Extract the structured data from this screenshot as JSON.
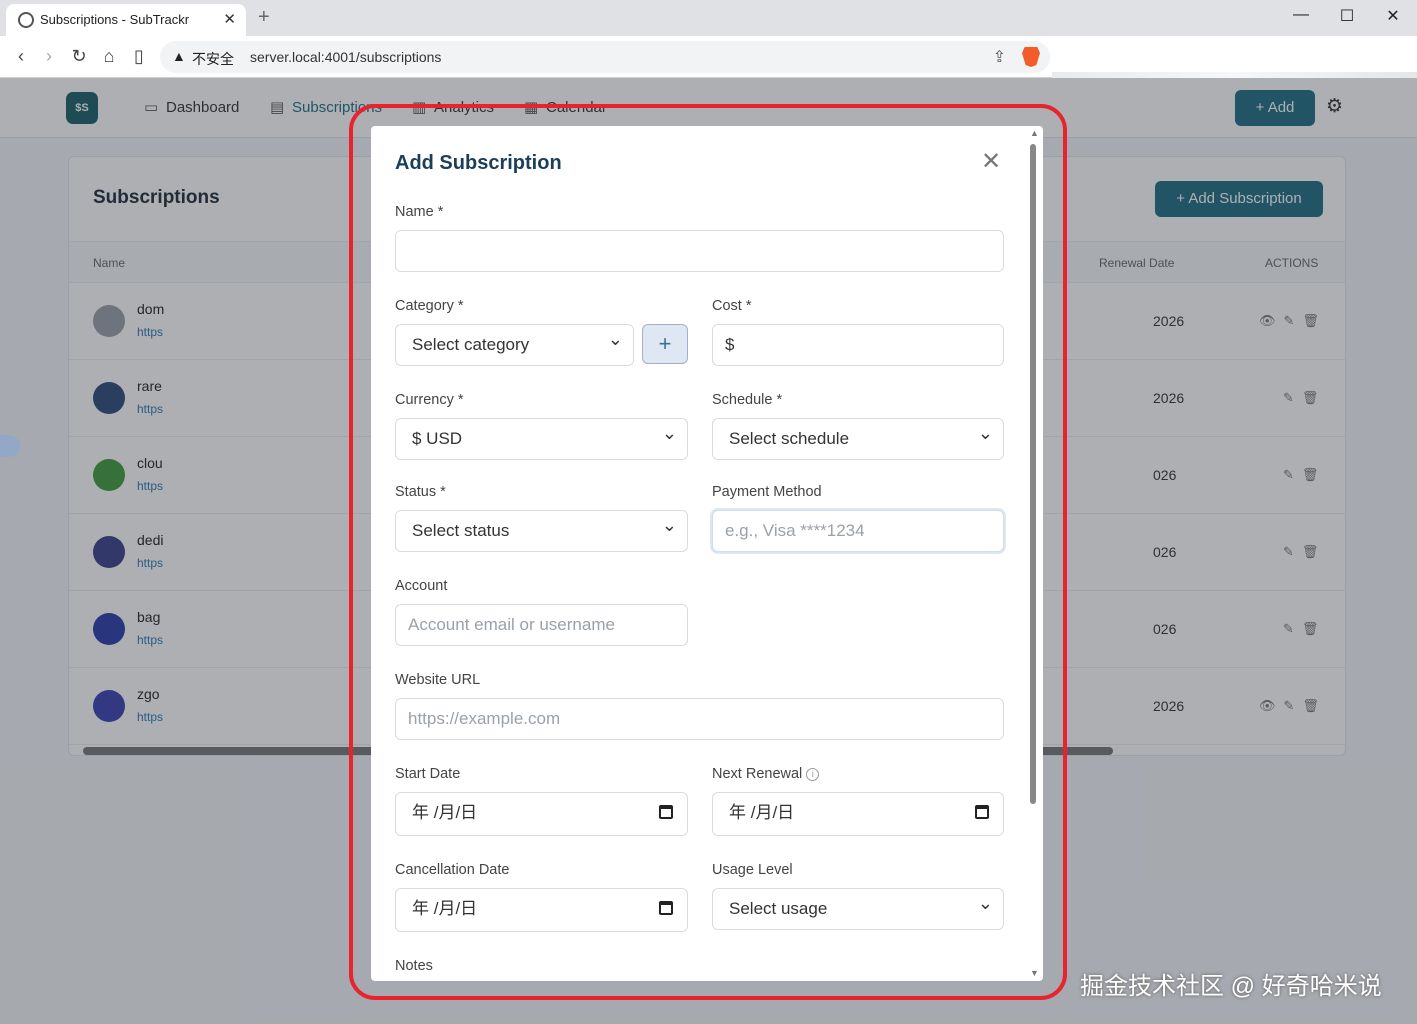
{
  "browser": {
    "tab_title": "Subscriptions - SubTrackr",
    "tab_close": "✕",
    "new_tab": "+",
    "minimize": "—",
    "maximize": "☐",
    "close": "✕",
    "security_label": "不安全",
    "url": "server.local:4001/subscriptions"
  },
  "app": {
    "logo_text": "$S",
    "nav": [
      "Dashboard",
      "Subscriptions",
      "Analytics",
      "Calendar"
    ],
    "top_add_label": "+ Add",
    "page_title": "Subscriptions",
    "add_subscription_label": "+ Add Subscription",
    "columns": {
      "name": "Name",
      "renewal": "Renewal Date",
      "actions": "ACTIONS"
    },
    "rows": [
      {
        "name": "dom",
        "link": "https",
        "date": "2026",
        "actions": "👁✎🗑",
        "color": "#9aa0a8"
      },
      {
        "name": "rare",
        "link": "https",
        "date": "2026",
        "actions": "✎🗑",
        "color": "#2c4a7a"
      },
      {
        "name": "clou",
        "link": "https",
        "date": "026",
        "actions": "✎🗑",
        "color": "#3e9c3a"
      },
      {
        "name": "dedi",
        "link": "https",
        "date": "026",
        "actions": "✎🗑",
        "color": "#3b3f8c"
      },
      {
        "name": "bag",
        "link": "https",
        "date": "026",
        "actions": "✎🗑",
        "color": "#2b3aa8"
      },
      {
        "name": "zgo",
        "link": "https",
        "date": "2026",
        "actions": "👁✎🗑",
        "color": "#3a3fb0"
      }
    ]
  },
  "modal": {
    "title": "Add Subscription",
    "close_icon": "✕",
    "name_label": "Name *",
    "name_value": "",
    "category_label": "Category *",
    "category_value": "Select category",
    "add_category_icon": "+",
    "cost_label": "Cost *",
    "cost_prefix": "$",
    "currency_label": "Currency *",
    "currency_value": "$ USD",
    "schedule_label": "Schedule *",
    "schedule_value": "Select schedule",
    "status_label": "Status *",
    "status_value": "Select status",
    "payment_label": "Payment Method",
    "payment_placeholder": "e.g., Visa ****1234",
    "account_label": "Account",
    "account_placeholder": "Account email or username",
    "website_label": "Website URL",
    "website_placeholder": "https://example.com",
    "start_label": "Start Date",
    "start_value": "年 /月/日",
    "renewal_label": "Next Renewal",
    "renewal_value": "年 /月/日",
    "cancel_label": "Cancellation Date",
    "cancel_value": "年 /月/日",
    "usage_label": "Usage Level",
    "usage_value": "Select usage",
    "notes_label": "Notes"
  },
  "watermark": "掘金技术社区 @ 好奇哈米说",
  "colors": {
    "accent": "#1d6e82",
    "highlight_ring": "#e8232e",
    "modal_title": "#1b3e5a"
  }
}
